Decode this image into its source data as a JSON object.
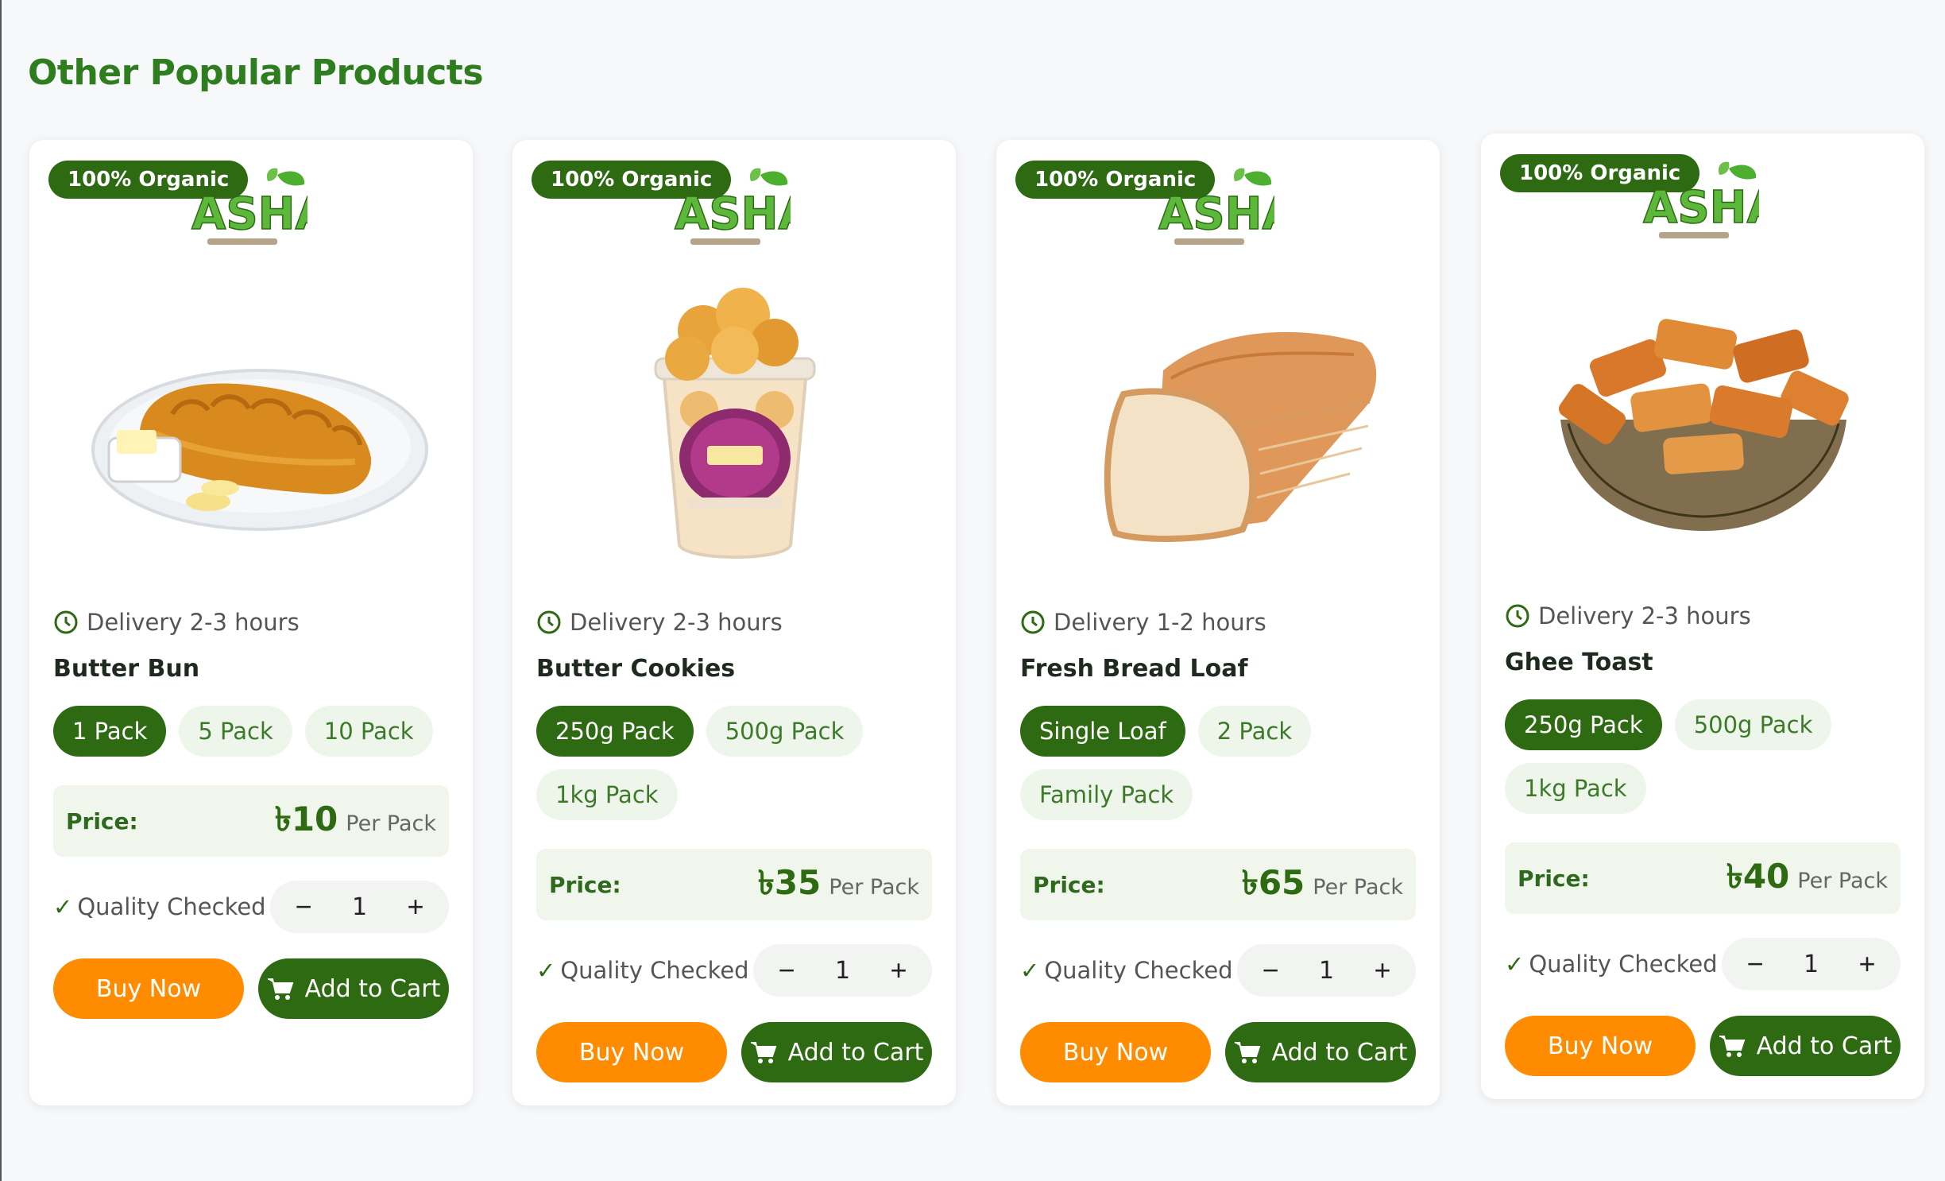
{
  "section": {
    "title": "Other Popular Products"
  },
  "colors": {
    "primary_green": "#2d6a12",
    "accent_orange": "#ff8c00",
    "badge_green": "#2d6a12",
    "title_green": "#2e7d1e"
  },
  "icons": {
    "clock": "clock-icon",
    "cart": "cart-icon",
    "check": "check-icon"
  },
  "products": [
    {
      "badge": "100% Organic",
      "delivery": "Delivery 2-3 hours",
      "name": "Butter Bun",
      "variants": [
        "1 Pack",
        "5 Pack",
        "10 Pack"
      ],
      "selected_variant": 0,
      "price_label": "Price:",
      "price": "৳10",
      "per": "Per Pack",
      "quality": "Quality Checked",
      "tick": "✓",
      "qty": "1",
      "minus": "−",
      "plus": "+",
      "buy": "Buy Now",
      "add_to_cart": "Add to Cart"
    },
    {
      "badge": "100% Organic",
      "delivery": "Delivery 2-3 hours",
      "name": "Butter Cookies",
      "variants": [
        "250g Pack",
        "500g Pack",
        "1kg Pack"
      ],
      "selected_variant": 0,
      "price_label": "Price:",
      "price": "৳35",
      "per": "Per Pack",
      "quality": "Quality Checked",
      "tick": "✓",
      "qty": "1",
      "minus": "−",
      "plus": "+",
      "buy": "Buy Now",
      "add_to_cart": "Add to Cart"
    },
    {
      "badge": "100% Organic",
      "delivery": "Delivery 1-2 hours",
      "name": "Fresh Bread Loaf",
      "variants": [
        "Single Loaf",
        "2 Pack",
        "Family Pack"
      ],
      "selected_variant": 0,
      "price_label": "Price:",
      "price": "৳65",
      "per": "Per Pack",
      "quality": "Quality Checked",
      "tick": "✓",
      "qty": "1",
      "minus": "−",
      "plus": "+",
      "buy": "Buy Now",
      "add_to_cart": "Add to Cart"
    },
    {
      "badge": "100% Organic",
      "delivery": "Delivery 2-3 hours",
      "name": "Ghee Toast",
      "variants": [
        "250g Pack",
        "500g Pack",
        "1kg Pack"
      ],
      "selected_variant": 0,
      "price_label": "Price:",
      "price": "৳40",
      "per": "Per Pack",
      "quality": "Quality Checked",
      "tick": "✓",
      "qty": "1",
      "minus": "−",
      "plus": "+",
      "buy": "Buy Now",
      "add_to_cart": "Add to Cart"
    }
  ]
}
